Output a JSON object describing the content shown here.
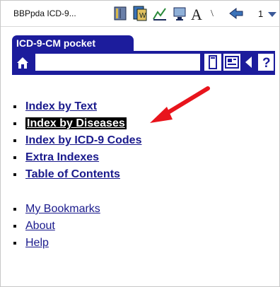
{
  "titlebar": {
    "app_title": "BBPpda ICD-9...",
    "count": "1",
    "icons": [
      "book-icon",
      "dictionary-icon",
      "chart-icon",
      "monitor-icon",
      "font-icon",
      "back-arrow-icon"
    ]
  },
  "tab": {
    "label": "ICD-9-CM pocket"
  },
  "toolbar": {
    "search_value": "",
    "buttons": [
      "home-icon",
      "bookmark-icon",
      "card-icon",
      "back-icon",
      "help-icon"
    ],
    "help_label": "?"
  },
  "menu": {
    "main_items": [
      {
        "label": "Index by Text"
      },
      {
        "label": "Index by Diseases",
        "selected": true
      },
      {
        "label": "Index by ICD-9 Codes"
      },
      {
        "label": "Extra Indexes"
      },
      {
        "label": "Table of Contents"
      }
    ],
    "secondary_items": [
      {
        "label": "My Bookmarks"
      },
      {
        "label": "About"
      },
      {
        "label": "Help"
      }
    ]
  },
  "colors": {
    "accent": "#1c1c9c",
    "link": "#1a1a8c",
    "annotation_arrow": "#e8141c"
  }
}
